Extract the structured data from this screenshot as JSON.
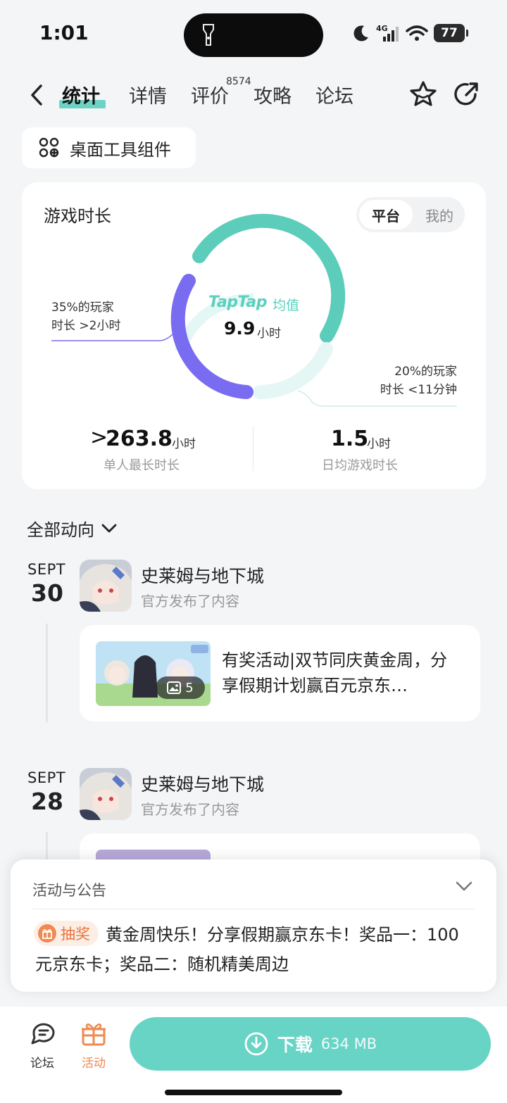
{
  "status_bar": {
    "time": "1:01",
    "network": "4G",
    "battery": "77"
  },
  "tabs": [
    {
      "label": "统计",
      "active": true
    },
    {
      "label": "详情"
    },
    {
      "label": "评价",
      "badge": "8574"
    },
    {
      "label": "攻略"
    },
    {
      "label": "论坛"
    }
  ],
  "widget_button": "桌面工具组件",
  "play_time_card": {
    "title": "游戏时长",
    "toggle": {
      "on": "平台",
      "off": "我的"
    },
    "center_brand": "TapTap",
    "center_brand_suffix": "均值",
    "center_value": "9.9",
    "center_unit": "小时",
    "left_note_line1": "35%的玩家",
    "left_note_line2": "时长 >2小时",
    "right_note_line1": "20%的玩家",
    "right_note_line2": "时长 <11分钟",
    "max_prefix": ">",
    "max_value": "263.8",
    "max_unit": "小时",
    "max_label": "单人最长时长",
    "daily_value": "1.5",
    "daily_unit": "小时",
    "daily_label": "日均游戏时长",
    "colors": {
      "purple": "#7a6cf0",
      "teal": "#5dcdbb",
      "light_teal": "#e4f7f4"
    }
  },
  "feed_filter": "全部动向",
  "feed": [
    {
      "month": "SEPT",
      "day": "30",
      "game": "史莱姆与地下城",
      "subtitle": "官方发布了内容",
      "post_text": "有奖活动|双节同庆黄金周，分享假期计划赢百元京东…",
      "image_count": "5"
    },
    {
      "month": "SEPT",
      "day": "28",
      "game": "史莱姆与地下城",
      "subtitle": "官方发布了内容"
    }
  ],
  "announcement": {
    "title": "活动与公告",
    "tag": "抽奖",
    "text": "黄金周快乐！分享假期赢京东卡！奖品一：100元京东卡；奖品二：随机精美周边"
  },
  "bottom_nav": {
    "forum": "论坛",
    "activity": "活动",
    "download_label": "下载",
    "download_size": "634 MB"
  }
}
